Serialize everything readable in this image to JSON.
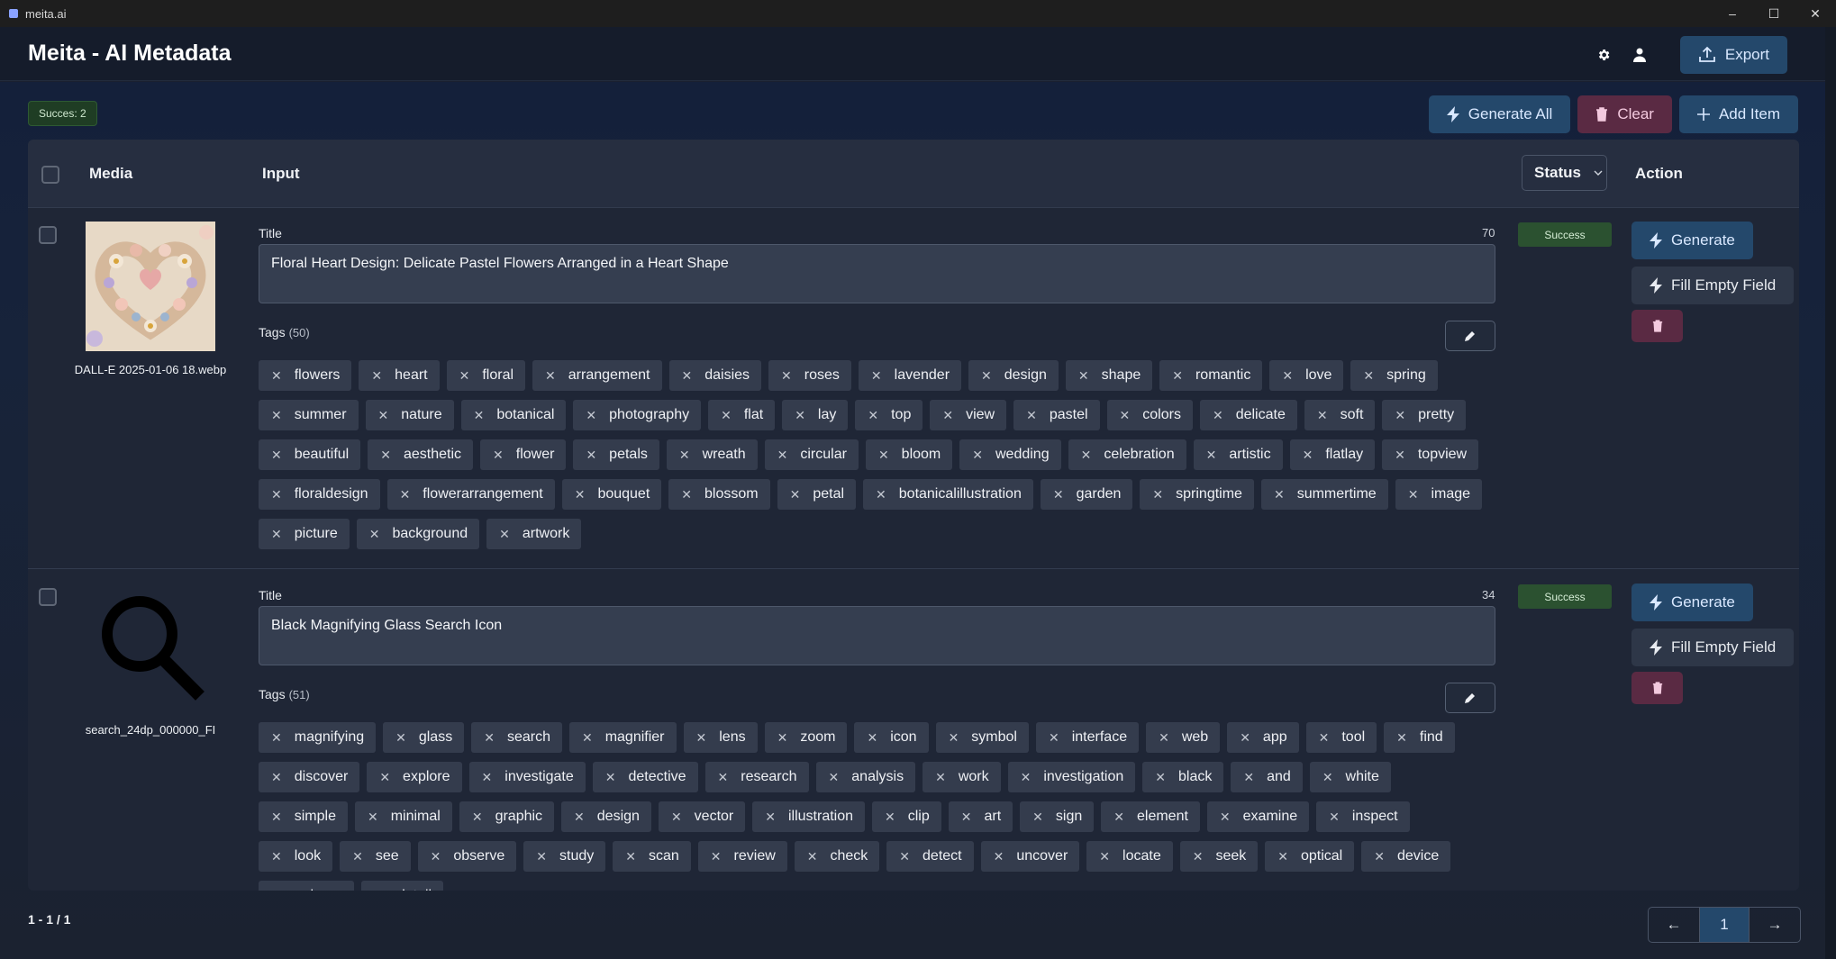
{
  "window": {
    "title": "meita.ai",
    "controls": [
      "–",
      "☐",
      "✕"
    ]
  },
  "header": {
    "title": "Meita - AI Metadata",
    "export_label": "Export"
  },
  "summary": {
    "success_badge": "Succes: 2"
  },
  "toolbar": {
    "generate_all": "Generate All",
    "clear": "Clear",
    "add_item": "Add Item"
  },
  "table": {
    "headers": {
      "media": "Media",
      "input": "Input",
      "status": "Status",
      "action": "Action"
    },
    "rows": [
      {
        "file_name": "DALL-E 2025-01-06 18.webp",
        "title_label": "Title",
        "title_count": "70",
        "title_value": "Floral Heart Design: Delicate Pastel Flowers Arranged in a Heart Shape",
        "tags_label": "Tags",
        "tags_count": "(50)",
        "status": "Success",
        "generate_label": "Generate",
        "fill_label": "Fill Empty Field",
        "tags": [
          "flowers",
          "heart",
          "floral",
          "arrangement",
          "daisies",
          "roses",
          "lavender",
          "design",
          "shape",
          "romantic",
          "love",
          "spring",
          "summer",
          "nature",
          "botanical",
          "photography",
          "flat",
          "lay",
          "top",
          "view",
          "pastel",
          "colors",
          "delicate",
          "soft",
          "pretty",
          "beautiful",
          "aesthetic",
          "flower",
          "petals",
          "wreath",
          "circular",
          "bloom",
          "wedding",
          "celebration",
          "artistic",
          "flatlay",
          "topview",
          "floraldesign",
          "flowerarrangement",
          "bouquet",
          "blossom",
          "petal",
          "botanicalillustration",
          "garden",
          "springtime",
          "summertime",
          "image",
          "picture",
          "background",
          "artwork"
        ]
      },
      {
        "file_name": "search_24dp_000000_FI",
        "title_label": "Title",
        "title_count": "34",
        "title_value": "Black Magnifying Glass Search Icon",
        "tags_label": "Tags",
        "tags_count": "(51)",
        "status": "Success",
        "generate_label": "Generate",
        "fill_label": "Fill Empty Field",
        "tags": [
          "magnifying",
          "glass",
          "search",
          "magnifier",
          "lens",
          "zoom",
          "icon",
          "symbol",
          "interface",
          "web",
          "app",
          "tool",
          "find",
          "discover",
          "explore",
          "investigate",
          "detective",
          "research",
          "analysis",
          "work",
          "investigation",
          "black",
          "and",
          "white",
          "simple",
          "minimal",
          "graphic",
          "design",
          "vector",
          "illustration",
          "clip",
          "art",
          "sign",
          "element",
          "examine",
          "inspect",
          "look",
          "see",
          "observe",
          "study",
          "scan",
          "review",
          "check",
          "detect",
          "uncover",
          "locate",
          "seek",
          "optical",
          "device",
          "enlarge",
          "detail"
        ]
      }
    ]
  },
  "footer": {
    "range": "1 - 1 / 1",
    "prev": "←",
    "page": "1",
    "next": "→"
  },
  "colors": {
    "primary_button": "#24486b",
    "danger_button": "#5a2a43",
    "success": "#2b5130"
  }
}
